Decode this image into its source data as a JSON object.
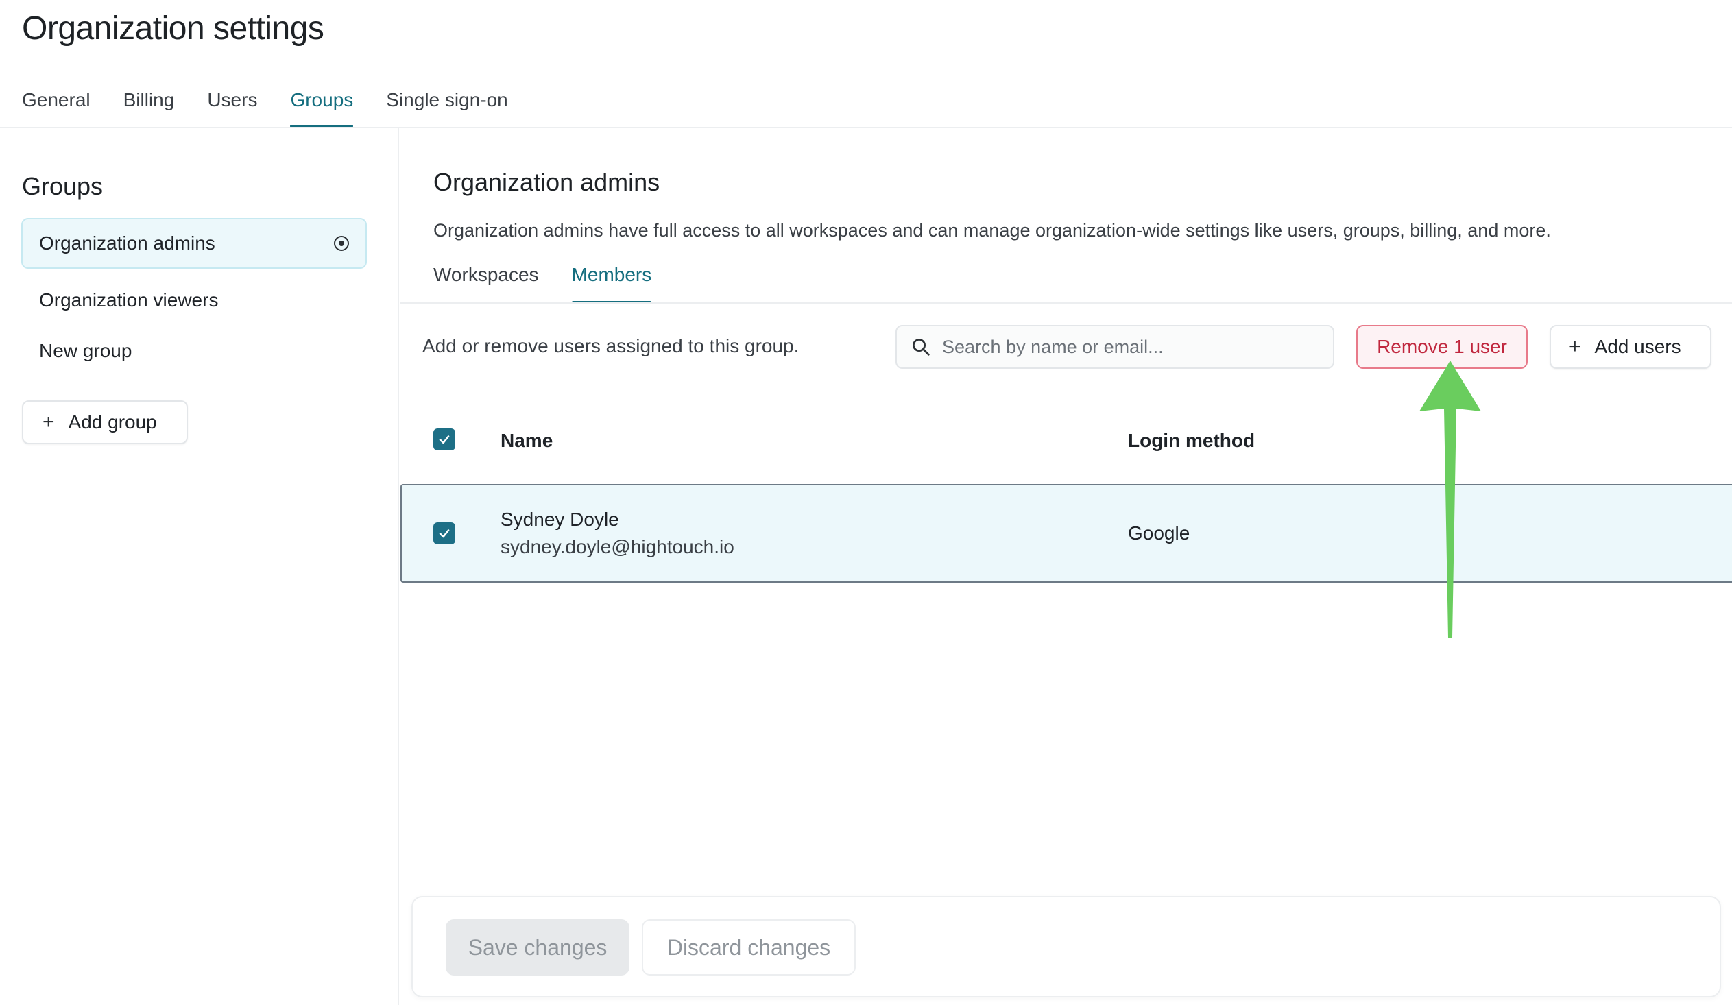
{
  "page": {
    "title": "Organization settings"
  },
  "top_tabs": [
    {
      "label": "General",
      "active": false
    },
    {
      "label": "Billing",
      "active": false
    },
    {
      "label": "Users",
      "active": false
    },
    {
      "label": "Groups",
      "active": true
    },
    {
      "label": "Single sign-on",
      "active": false
    }
  ],
  "sidebar": {
    "title": "Groups",
    "groups": [
      {
        "label": "Organization admins",
        "active": true
      },
      {
        "label": "Organization viewers",
        "active": false
      },
      {
        "label": "New group",
        "active": false
      }
    ],
    "add_group_label": "Add group"
  },
  "main": {
    "title": "Organization admins",
    "description": "Organization admins have full access to all workspaces and can manage organization-wide settings like users, groups, billing, and more.",
    "sub_tabs": [
      {
        "label": "Workspaces",
        "active": false
      },
      {
        "label": "Members",
        "active": true
      }
    ],
    "hint": "Add or remove users assigned to this group.",
    "search": {
      "placeholder": "Search by name or email...",
      "value": ""
    },
    "remove_button_label": "Remove 1 user",
    "add_users_label": "Add users",
    "table": {
      "columns": [
        "Name",
        "Login method"
      ],
      "header_checked": true,
      "rows": [
        {
          "name": "Sydney Doyle",
          "email": "sydney.doyle@hightouch.io",
          "login_method": "Google",
          "checked": true
        }
      ]
    }
  },
  "footer": {
    "save_label": "Save changes",
    "discard_label": "Discard changes"
  },
  "colors": {
    "accent": "#156e7f",
    "checkbox": "#1d6f86",
    "danger": "#c0263d",
    "selected_row_bg": "#ecf8fb",
    "annotation_arrow": "#6acd5e"
  },
  "icons": {
    "search": "search-icon",
    "plus": "plus-icon",
    "radio": "radio-selected-icon",
    "check": "check-icon",
    "annotation": "arrow-up-icon"
  }
}
